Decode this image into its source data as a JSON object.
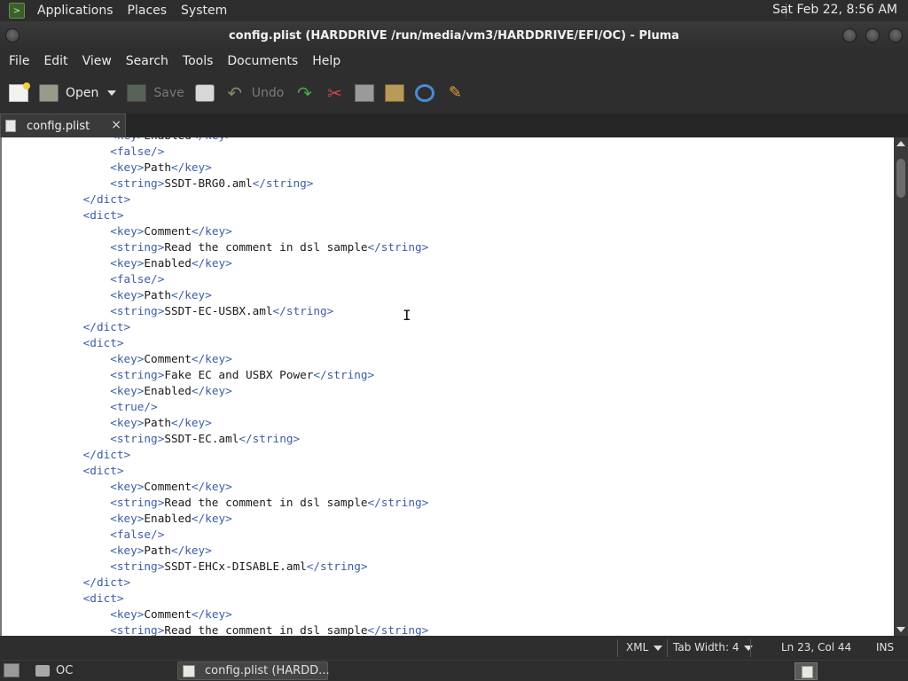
{
  "top_panel": {
    "menus": [
      "Applications",
      "Places",
      "System"
    ],
    "clock": "Sat Feb 22,  8:56 AM"
  },
  "window": {
    "title": "config.plist (HARDDRIVE /run/media/vm3/HARDDRIVE/EFI/OC) - Pluma"
  },
  "menubar": [
    "File",
    "Edit",
    "View",
    "Search",
    "Tools",
    "Documents",
    "Help"
  ],
  "toolbar": {
    "open_label": "Open",
    "save_label": "Save",
    "undo_label": "Undo"
  },
  "tab": {
    "label": "config.plist",
    "close": "×"
  },
  "editor": {
    "lines": [
      {
        "indent": 2,
        "open": "<key>",
        "text": "Enabled",
        "close": "</key>"
      },
      {
        "indent": 2,
        "open": "<false/>",
        "text": "",
        "close": ""
      },
      {
        "indent": 2,
        "open": "<key>",
        "text": "Path",
        "close": "</key>"
      },
      {
        "indent": 2,
        "open": "<string>",
        "text": "SSDT-BRG0.aml",
        "close": "</string>"
      },
      {
        "indent": 1,
        "open": "</dict>",
        "text": "",
        "close": ""
      },
      {
        "indent": 1,
        "open": "<dict>",
        "text": "",
        "close": ""
      },
      {
        "indent": 2,
        "open": "<key>",
        "text": "Comment",
        "close": "</key>"
      },
      {
        "indent": 2,
        "open": "<string>",
        "text": "Read the comment in dsl sample",
        "close": "</string>"
      },
      {
        "indent": 2,
        "open": "<key>",
        "text": "Enabled",
        "close": "</key>"
      },
      {
        "indent": 2,
        "open": "<false/>",
        "text": "",
        "close": ""
      },
      {
        "indent": 2,
        "open": "<key>",
        "text": "Path",
        "close": "</key>"
      },
      {
        "indent": 2,
        "open": "<string>",
        "text": "SSDT-EC-USBX.aml",
        "close": "</string>"
      },
      {
        "indent": 1,
        "open": "</dict>",
        "text": "",
        "close": ""
      },
      {
        "indent": 1,
        "open": "<dict>",
        "text": "",
        "close": ""
      },
      {
        "indent": 2,
        "open": "<key>",
        "text": "Comment",
        "close": "</key>"
      },
      {
        "indent": 2,
        "open": "<string>",
        "text": "Fake EC and USBX Power",
        "close": "</string>"
      },
      {
        "indent": 2,
        "open": "<key>",
        "text": "Enabled",
        "close": "</key>"
      },
      {
        "indent": 2,
        "open": "<true/>",
        "text": "",
        "close": ""
      },
      {
        "indent": 2,
        "open": "<key>",
        "text": "Path",
        "close": "</key>"
      },
      {
        "indent": 2,
        "open": "<string>",
        "text": "SSDT-EC.aml",
        "close": "</string>"
      },
      {
        "indent": 1,
        "open": "</dict>",
        "text": "",
        "close": ""
      },
      {
        "indent": 1,
        "open": "<dict>",
        "text": "",
        "close": ""
      },
      {
        "indent": 2,
        "open": "<key>",
        "text": "Comment",
        "close": "</key>"
      },
      {
        "indent": 2,
        "open": "<string>",
        "text": "Read the comment in dsl sample",
        "close": "</string>"
      },
      {
        "indent": 2,
        "open": "<key>",
        "text": "Enabled",
        "close": "</key>"
      },
      {
        "indent": 2,
        "open": "<false/>",
        "text": "",
        "close": ""
      },
      {
        "indent": 2,
        "open": "<key>",
        "text": "Path",
        "close": "</key>"
      },
      {
        "indent": 2,
        "open": "<string>",
        "text": "SSDT-EHCx-DISABLE.aml",
        "close": "</string>"
      },
      {
        "indent": 1,
        "open": "</dict>",
        "text": "",
        "close": ""
      },
      {
        "indent": 1,
        "open": "<dict>",
        "text": "",
        "close": ""
      },
      {
        "indent": 2,
        "open": "<key>",
        "text": "Comment",
        "close": "</key>"
      },
      {
        "indent": 2,
        "open": "<string>",
        "text": "Read the comment in dsl sample",
        "close": "</string>"
      }
    ]
  },
  "statusbar": {
    "language": "XML",
    "tab_width": "Tab Width:  4",
    "position": "Ln 23, Col 44",
    "mode": "INS"
  },
  "taskbar": {
    "folder_label": "OC",
    "window_label": "config.plist (HARDD..."
  },
  "colors": {
    "tag": "#3b5ea8",
    "text": "#1a1a1a",
    "editor_bg": "#ffffff",
    "chrome_bg": "#2e2e2e"
  }
}
